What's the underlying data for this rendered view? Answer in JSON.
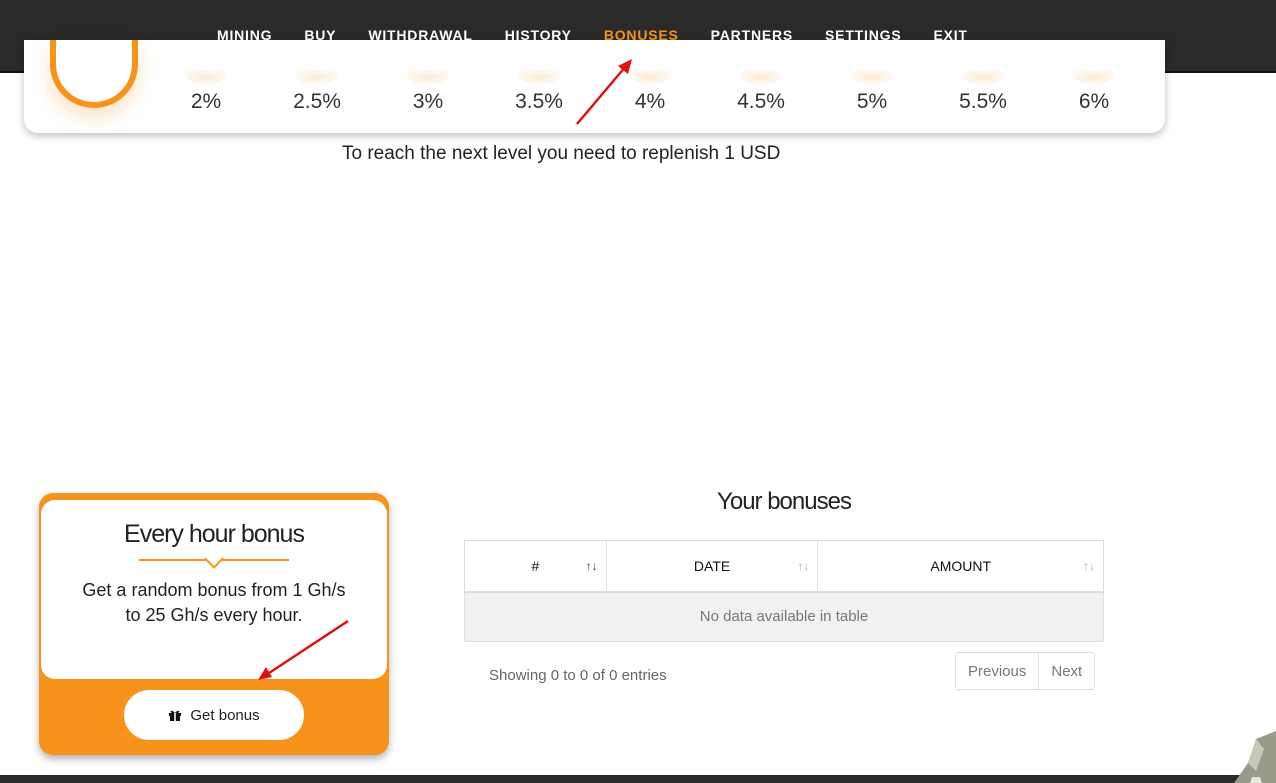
{
  "nav": {
    "items": [
      {
        "label": "MINING",
        "active": false
      },
      {
        "label": "BUY",
        "active": false
      },
      {
        "label": "WITHDRAWAL",
        "active": false
      },
      {
        "label": "HISTORY",
        "active": false
      },
      {
        "label": "BONUSES",
        "active": true
      },
      {
        "label": "PARTNERS",
        "active": false
      },
      {
        "label": "SETTINGS",
        "active": false
      },
      {
        "label": "EXIT",
        "active": false
      }
    ],
    "active_color": "#f7931a"
  },
  "levels": {
    "percents": [
      "2%",
      "2.5%",
      "3%",
      "3.5%",
      "4%",
      "4.5%",
      "5%",
      "5.5%",
      "6%"
    ],
    "next_level_text": "To reach the next level you need to replenish 1 USD"
  },
  "hourly_bonus": {
    "title": "Every hour bonus",
    "description": "Get a random bonus from 1 Gh/s to 25 Gh/s every hour.",
    "button_label": "Get bonus",
    "button_icon": "gift-icon"
  },
  "bonuses_table": {
    "title": "Your bonuses",
    "columns": [
      "#",
      "DATE",
      "AMOUNT"
    ],
    "empty_text": "No data available in table",
    "info_text": "Showing 0 to 0 of 0 entries",
    "prev_label": "Previous",
    "next_label": "Next"
  },
  "colors": {
    "accent": "#f7931a",
    "navbar_bg": "#2a2a2a",
    "annotation": "#e01010"
  }
}
